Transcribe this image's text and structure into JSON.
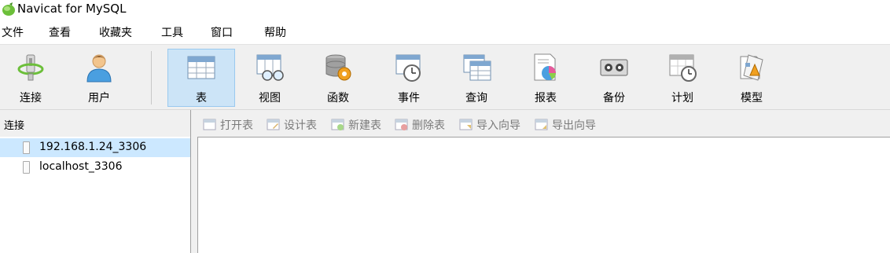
{
  "window": {
    "title": "Navicat for MySQL"
  },
  "menu": [
    "文件",
    "查看",
    "收藏夹",
    "工具",
    "窗口",
    "帮助"
  ],
  "toolbar": {
    "connect": "连接",
    "user": "用户",
    "table": "表",
    "view": "视图",
    "function": "函数",
    "event": "事件",
    "query": "查询",
    "report": "报表",
    "backup": "备份",
    "schedule": "计划",
    "model": "模型"
  },
  "sidebar": {
    "header": "连接",
    "connections": [
      {
        "name": "192.168.1.24_3306",
        "selected": true
      },
      {
        "name": "localhost_3306",
        "selected": false
      }
    ]
  },
  "object_toolbar": {
    "open_table": "打开表",
    "design_table": "设计表",
    "new_table": "新建表",
    "delete_table": "删除表",
    "import_wizard": "导入向导",
    "export_wizard": "导出向导"
  },
  "colors": {
    "selected": "#cce8ff",
    "active_tool": "#cce4f7",
    "disabled_text": "#7a7a7a"
  }
}
